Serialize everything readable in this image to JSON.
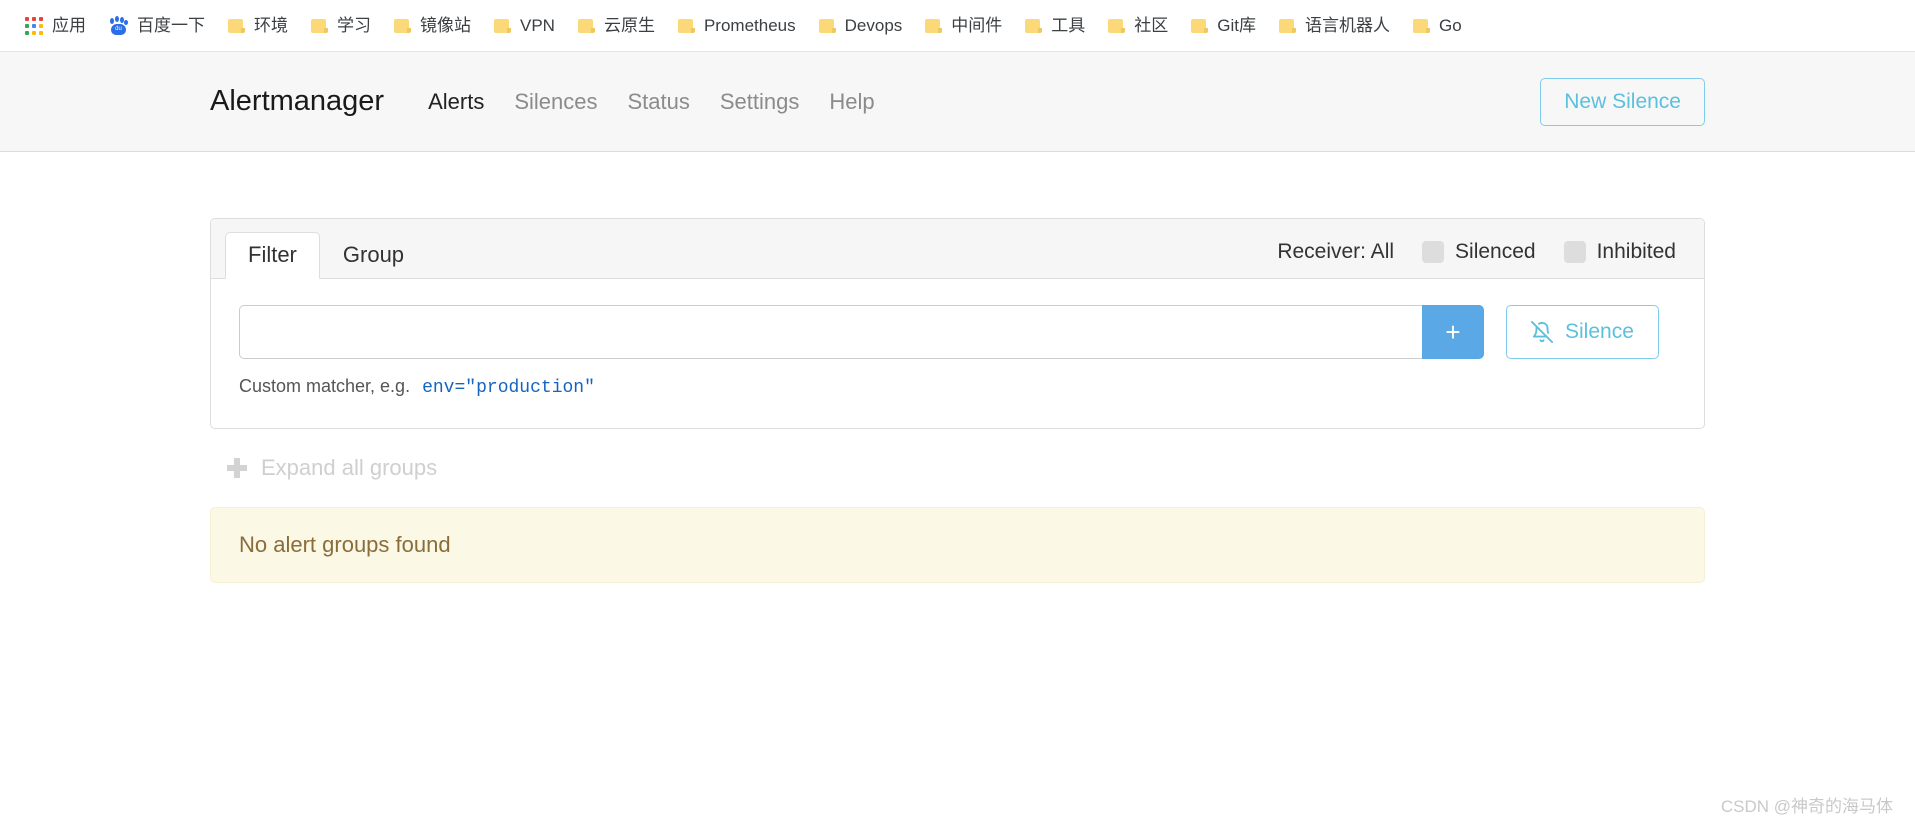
{
  "browser": {
    "bookmarks": [
      {
        "label": "应用",
        "icon": "apps-grid-icon"
      },
      {
        "label": "百度一下",
        "icon": "baidu-icon"
      },
      {
        "label": "环境",
        "icon": "folder-icon"
      },
      {
        "label": "学习",
        "icon": "folder-icon"
      },
      {
        "label": "镜像站",
        "icon": "folder-icon"
      },
      {
        "label": "VPN",
        "icon": "folder-icon"
      },
      {
        "label": "云原生",
        "icon": "folder-icon"
      },
      {
        "label": "Prometheus",
        "icon": "folder-icon"
      },
      {
        "label": "Devops",
        "icon": "folder-icon"
      },
      {
        "label": "中间件",
        "icon": "folder-icon"
      },
      {
        "label": "工具",
        "icon": "folder-icon"
      },
      {
        "label": "社区",
        "icon": "folder-icon"
      },
      {
        "label": "Git库",
        "icon": "folder-icon"
      },
      {
        "label": "语言机器人",
        "icon": "folder-icon"
      },
      {
        "label": "Go",
        "icon": "folder-icon"
      }
    ],
    "apps_icon_colors": [
      "#ea4335",
      "#ea4335",
      "#ea4335",
      "#34a853",
      "#4285f4",
      "#fbbc05",
      "#34a853",
      "#fbbc05",
      "#fbbc05"
    ]
  },
  "navbar": {
    "brand": "Alertmanager",
    "links": [
      {
        "label": "Alerts",
        "active": true
      },
      {
        "label": "Silences",
        "active": false
      },
      {
        "label": "Status",
        "active": false
      },
      {
        "label": "Settings",
        "active": false
      },
      {
        "label": "Help",
        "active": false
      }
    ],
    "new_silence_label": "New Silence"
  },
  "filter_card": {
    "tabs": [
      {
        "label": "Filter",
        "active": true
      },
      {
        "label": "Group",
        "active": false
      }
    ],
    "receiver_label": "Receiver: All",
    "toggles": [
      {
        "label": "Silenced",
        "checked": false
      },
      {
        "label": "Inhibited",
        "checked": false
      }
    ],
    "matcher_input_value": "",
    "matcher_input_placeholder": "",
    "add_button_label": "+",
    "silence_button_label": "Silence",
    "silence_button_icon": "bell-off-icon",
    "help_text": "Custom matcher, e.g.",
    "help_code": "env=\"production\""
  },
  "groups": {
    "expand_all_label": "Expand all groups",
    "expand_icon": "plus-icon",
    "empty_message": "No alert groups found"
  },
  "watermark": "CSDN @神奇的海马体",
  "colors": {
    "accent": "#5bc0de",
    "add_button": "#5aa8e6",
    "warning_bg": "#fcf8e6",
    "warning_text": "#8a6d3b",
    "navbar_bg": "#f7f7f7"
  }
}
